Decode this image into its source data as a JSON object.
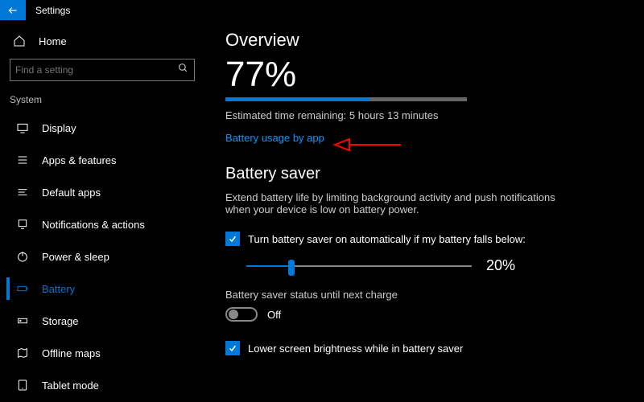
{
  "titlebar": {
    "title": "Settings"
  },
  "sidebar": {
    "home_label": "Home",
    "search_placeholder": "Find a setting",
    "section_label": "System",
    "items": [
      {
        "label": "Display"
      },
      {
        "label": "Apps & features"
      },
      {
        "label": "Default apps"
      },
      {
        "label": "Notifications & actions"
      },
      {
        "label": "Power & sleep"
      },
      {
        "label": "Battery"
      },
      {
        "label": "Storage"
      },
      {
        "label": "Offline maps"
      },
      {
        "label": "Tablet mode"
      }
    ],
    "active_index": 5
  },
  "main": {
    "overview_heading": "Overview",
    "battery_percent_text": "77%",
    "battery_percent_value": 77,
    "time_remaining": "Estimated time remaining: 5 hours 13 minutes",
    "usage_link": "Battery usage by app",
    "saver_heading": "Battery saver",
    "saver_desc": "Extend battery life by limiting background activity and push notifications when your device is low on battery power.",
    "auto_on_label": "Turn battery saver on automatically if my battery falls below:",
    "threshold_text": "20%",
    "threshold_value": 20,
    "status_label": "Battery saver status until next charge",
    "toggle_state": "Off",
    "brightness_label": "Lower screen brightness while in battery saver"
  },
  "colors": {
    "accent": "#0078d7",
    "link": "#0099ff"
  }
}
